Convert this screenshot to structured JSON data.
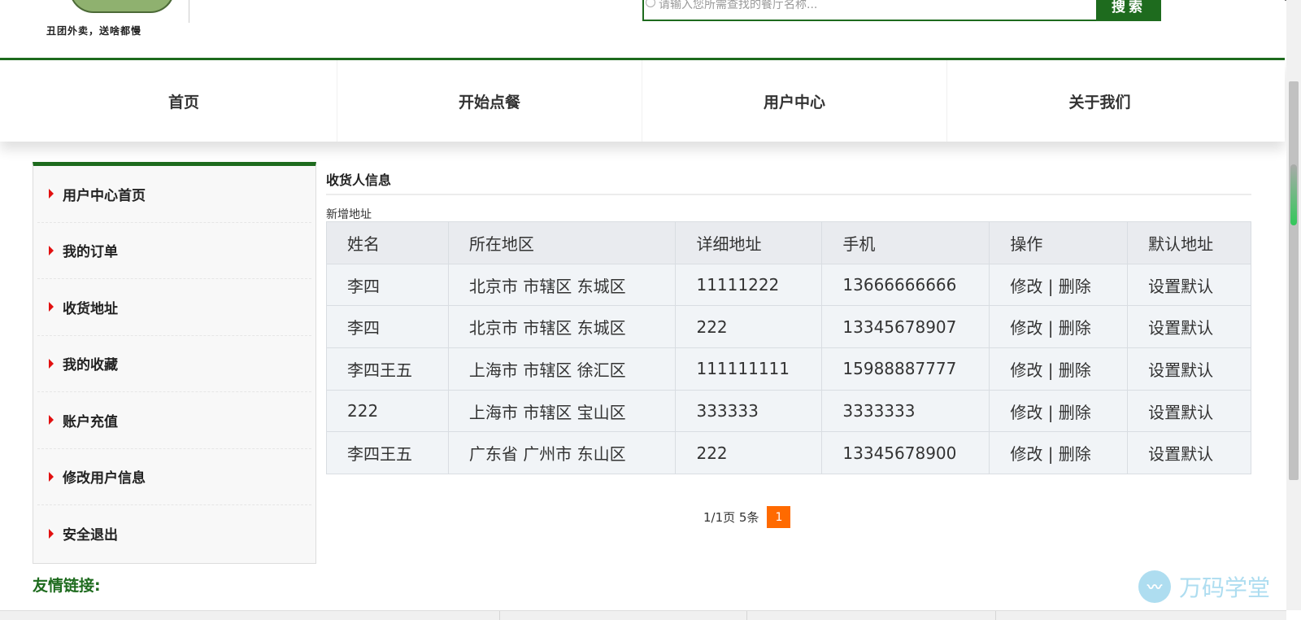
{
  "header": {
    "logo_slogan": "丑团外卖，送啥都慢",
    "search_placeholder": "请输入您所需查找的餐厅名称...",
    "search_button": "搜索"
  },
  "nav": {
    "items": [
      "首页",
      "开始点餐",
      "用户中心",
      "关于我们"
    ]
  },
  "sidebar": {
    "items": [
      "用户中心首页",
      "我的订单",
      "收货地址",
      "我的收藏",
      "账户充值",
      "修改用户信息",
      "安全退出"
    ]
  },
  "footer": {
    "friend_links": "友情链接:"
  },
  "main": {
    "title": "收货人信息",
    "new_address": "新增地址",
    "table": {
      "headers": [
        "姓名",
        "所在地区",
        "详细地址",
        "手机",
        "操作",
        "默认地址"
      ],
      "rows": [
        {
          "name": "李四",
          "region": "北京市 市辖区 东城区",
          "detail": "11111222",
          "phone": "13666666666"
        },
        {
          "name": "李四",
          "region": "北京市 市辖区 东城区",
          "detail": "222",
          "phone": "13345678907"
        },
        {
          "name": "李四王五",
          "region": "上海市 市辖区 徐汇区",
          "detail": "111111111",
          "phone": "15988887777"
        },
        {
          "name": "222",
          "region": "上海市 市辖区 宝山区",
          "detail": "333333",
          "phone": "3333333"
        },
        {
          "name": "李四王五",
          "region": "广东省 广州市 东山区",
          "detail": "222",
          "phone": "13345678900"
        }
      ],
      "edit_label": "修改",
      "separator": "|",
      "delete_label": "删除",
      "set_default_label": "设置默认"
    },
    "pager": {
      "info": "1/1页 5条",
      "current": "1"
    }
  },
  "watermark": {
    "text": "万码学堂"
  },
  "colors": {
    "brand_green": "#1e6b1e",
    "arrow_red": "#e21010",
    "pager_orange": "#ff6a00"
  }
}
